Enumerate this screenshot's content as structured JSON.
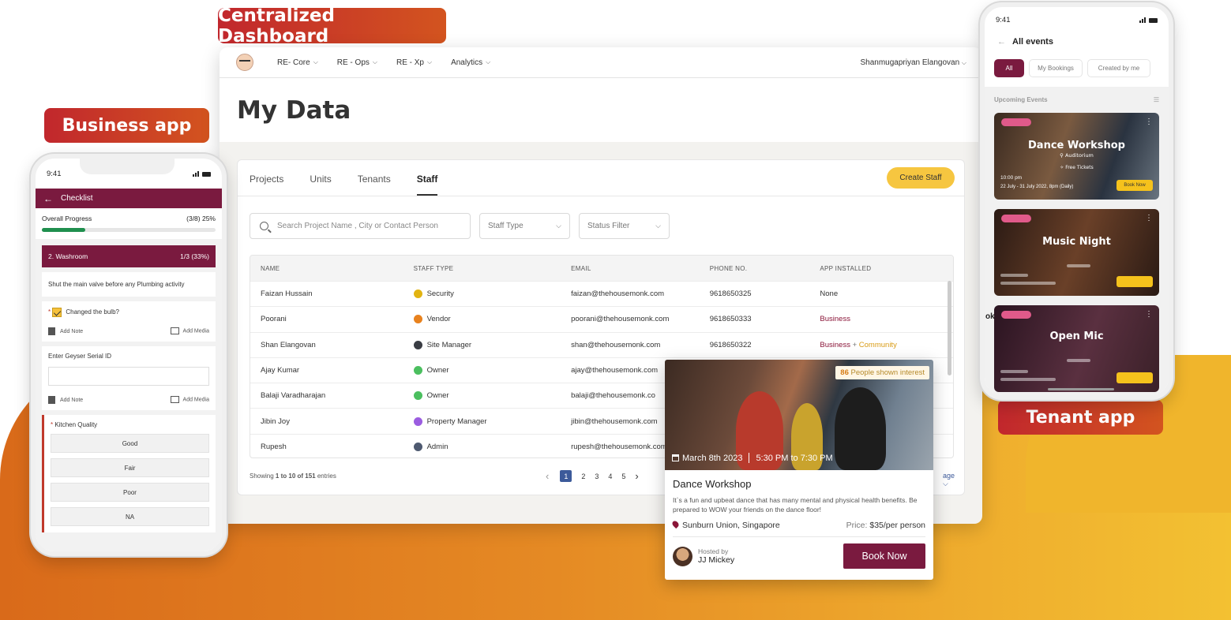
{
  "labels": {
    "dashboard": "Centralized Dashboard",
    "business": "Business app",
    "tenant": "Tenant app"
  },
  "colors": {
    "brand": "#7a1a3f",
    "accent_yellow": "#f6c640",
    "badge_red": "#c1272d",
    "background_orange": "#e58a24"
  },
  "dashboard": {
    "nav": [
      "RE- Core",
      "RE - Ops",
      "RE - Xp",
      "Analytics"
    ],
    "user": "Shanmugapriyan Elangovan",
    "title": "My Data",
    "tabs": [
      "Projects",
      "Units",
      "Tenants",
      "Staff"
    ],
    "active_tab": "Staff",
    "create_button": "Create Staff",
    "search_placeholder": "Search Project Name , City or Contact Person",
    "filter_staff_type": "Staff Type",
    "filter_status": "Status Filter",
    "columns": [
      "NAME",
      "STAFF TYPE",
      "EMAIL",
      "PHONE NO.",
      "APP INSTALLED"
    ],
    "rows": [
      {
        "name": "Faizan Hussain",
        "type": "Security",
        "dot": "#e2b412",
        "email": "faizan@thehousemonk.com",
        "phone": "9618650325",
        "app": "None",
        "app2": ""
      },
      {
        "name": "Poorani",
        "type": "Vendor",
        "dot": "#e8821e",
        "email": "poorani@thehousemonk.com",
        "phone": "9618650333",
        "app": "Business",
        "app2": ""
      },
      {
        "name": "Shan Elangovan",
        "type": "Site Manager",
        "dot": "#3a3d44",
        "email": "shan@thehousemonk.com",
        "phone": "9618650322",
        "app": "Business",
        "app2": "Community"
      },
      {
        "name": "Ajay Kumar",
        "type": "Owner",
        "dot": "#4bbf5f",
        "email": "ajay@thehousemonk.com",
        "phone": "",
        "app": "",
        "app2": ""
      },
      {
        "name": "Balaji Varadharajan",
        "type": "Owner",
        "dot": "#4bbf5f",
        "email": "balaji@thehousemonk.co",
        "phone": "",
        "app": "",
        "app2": ""
      },
      {
        "name": "Jibin Joy",
        "type": "Property Manager",
        "dot": "#9b5de0",
        "email": "jibin@thehousemonk.com",
        "phone": "",
        "app": "",
        "app2": ""
      },
      {
        "name": "Rupesh",
        "type": "Admin",
        "dot": "#4e5a70",
        "email": "rupesh@thehousemonk.com",
        "phone": "",
        "app": "",
        "app2": ""
      }
    ],
    "showing_prefix": "Showing ",
    "showing_range": "1 to 10 of 151",
    "showing_suffix": " entries",
    "pages": [
      "1",
      "2",
      "3",
      "4",
      "5"
    ],
    "per_page_fragment": "age"
  },
  "event_card": {
    "interest_count": "86",
    "interest_text": "People shown interest",
    "date": "March 8th 2023",
    "time": "5:30 PM to 7:30 PM",
    "title": "Dance Workshop",
    "description": "It`s a fun and upbeat dance that has many mental and physical health benefits. Be prepared to WOW your friends on the dance floor!",
    "location": "Sunburn Union, Singapore",
    "price_label": "Price:",
    "price": "$35/per person",
    "hosted_by_label": "Hosted by",
    "host": "JJ Mickey",
    "book_button": "Book Now"
  },
  "business_app": {
    "time": "9:41",
    "header": "Checklist",
    "overall_label": "Overall Progress",
    "overall_value": "(3/8) 25%",
    "progress": 0.25,
    "section": "2. Washroom",
    "section_value": "1/3 (33%)",
    "instruction": "Shut the main valve before any Plumbing activity",
    "task": "Changed the bulb?",
    "add_note": "Add Note",
    "add_media": "Add Media",
    "geyser_label": "Enter Geyser Serial ID",
    "quality_label": "Kitchen Quality",
    "options": [
      "Good",
      "Fair",
      "Poor",
      "NA"
    ]
  },
  "tenant_app": {
    "time": "9:41",
    "header": "All events",
    "chips": [
      "All",
      "My Bookings",
      "Created by me"
    ],
    "upcoming": "Upcoming Events",
    "events": [
      {
        "title": "Dance Workshop",
        "venue": "Auditorium",
        "ticket": "Free Tickets",
        "time": "10:00 pm",
        "dates": "22 July - 31 July 2022, 8pm (Daily)",
        "button": "Book Now"
      },
      {
        "title": "Music Night"
      },
      {
        "title": "Open Mic"
      }
    ],
    "side_fragment": "ok"
  }
}
